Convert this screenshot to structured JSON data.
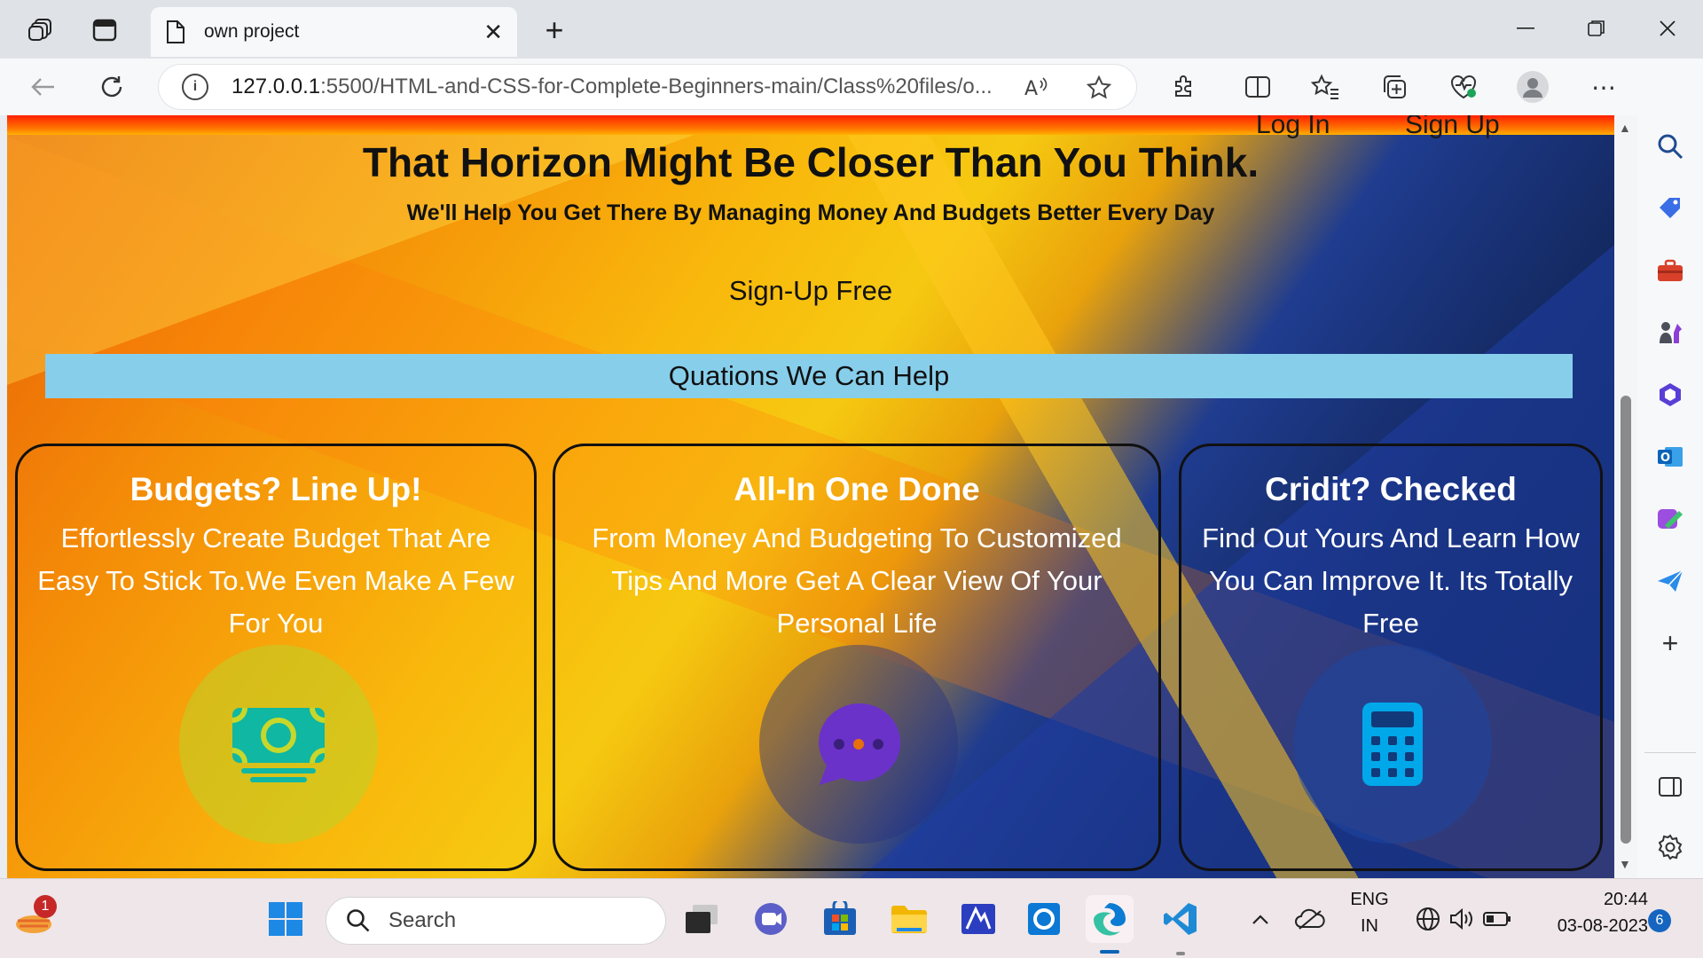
{
  "browser": {
    "tab_title": "own project",
    "url_host": "127.0.0.1",
    "url_rest": ":5500/HTML-and-CSS-for-Complete-Beginners-main/Class%20files/o...",
    "new_tab_symbol": "+",
    "close_symbol": "✕"
  },
  "page": {
    "nav": {
      "login": "Log In",
      "signup": "Sign Up"
    },
    "hero_title": "That Horizon Might Be Closer Than You Think.",
    "hero_subtitle": "We'll Help You Get There By Managing Money And Budgets Better Every Day",
    "signup_button": "Sign-Up Free",
    "questions_bar": "Quations We Can Help",
    "cards": [
      {
        "title": "Budgets? Line Up!",
        "text": "Effortlessly Create Budget That Are Easy To Stick To.We Even Make A Few For You",
        "icon": "money-icon",
        "color": "#10b7a2"
      },
      {
        "title": "All-In One Done",
        "text": "From Money And Budgeting To Customized Tips And More Get A Clear View Of Your Personal Life",
        "icon": "chat-bubble-icon",
        "color": "#6a32c9"
      },
      {
        "title": "Cridit? Checked",
        "text": "Find Out Yours And Learn How You Can Improve It. Its Totally Free",
        "icon": "calculator-icon",
        "color": "#00a8ea"
      }
    ]
  },
  "taskbar": {
    "search_placeholder": "Search",
    "notification_count": "1",
    "lang_top": "ENG",
    "lang_bottom": "IN",
    "time": "20:44",
    "date": "03-08-2023",
    "notification_center_count": "6"
  }
}
